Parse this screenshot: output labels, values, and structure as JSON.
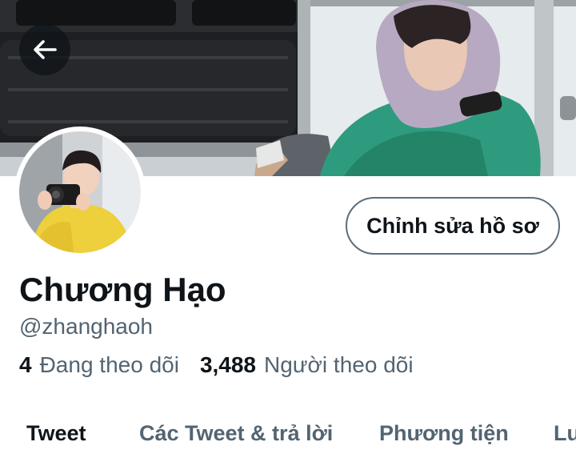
{
  "profile": {
    "display_name": "Chương Hạo",
    "handle": "@zhanghaoh",
    "edit_button_label": "Chỉnh sửa hồ sơ"
  },
  "stats": {
    "following_count": "4",
    "following_label": "Đang theo dõi",
    "followers_count": "3,488",
    "followers_label": "Người theo dõi"
  },
  "tabs": [
    {
      "label": "Tweet",
      "active": true
    },
    {
      "label": "Các Tweet & trả lời",
      "active": false
    },
    {
      "label": "Phương tiện",
      "active": false
    },
    {
      "label": "Lư",
      "active": false
    }
  ],
  "icons": {
    "back": "arrow-left-icon"
  },
  "colors": {
    "text_primary": "#0f1419",
    "text_secondary": "#536471",
    "button_border": "#5b6e7a",
    "background": "#ffffff"
  }
}
